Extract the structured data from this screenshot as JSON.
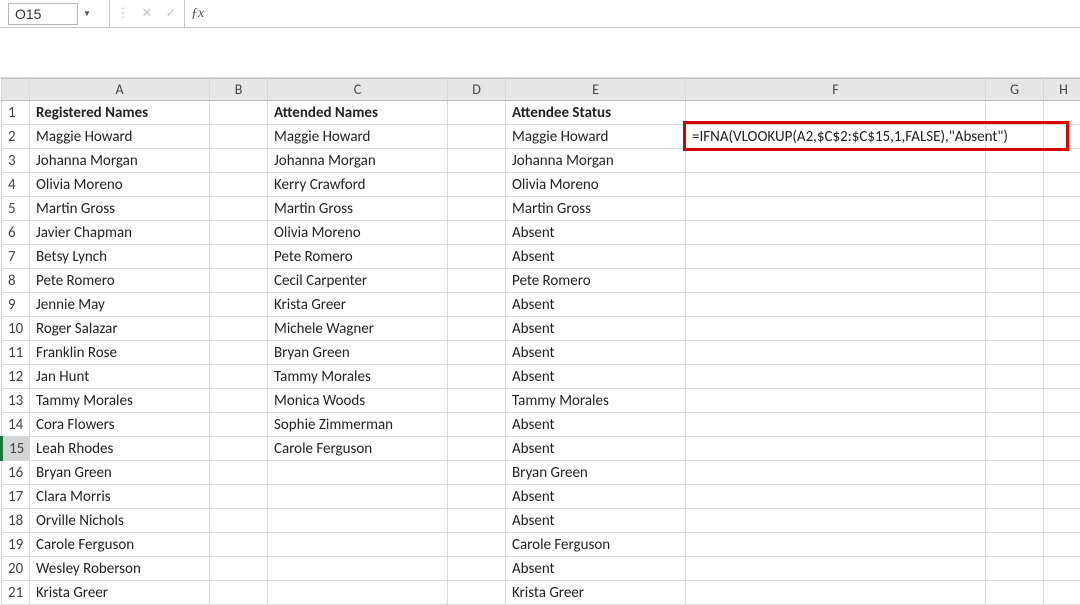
{
  "namebox": {
    "value": "O15"
  },
  "columns": [
    "A",
    "B",
    "C",
    "D",
    "E",
    "F",
    "G",
    "H"
  ],
  "activeRowHeader": 15,
  "headers": {
    "A": "Registered Names",
    "C": "Attended Names",
    "E": "Attendee Status"
  },
  "formulaDisplay": "=IFNA(VLOOKUP(A2,$C$2:$C$15,1,FALSE),\"Absent\")",
  "rows": [
    {
      "n": 2,
      "A": "Maggie Howard",
      "C": "Maggie Howard",
      "E": "Maggie Howard"
    },
    {
      "n": 3,
      "A": "Johanna Morgan",
      "C": "Johanna Morgan",
      "E": "Johanna Morgan"
    },
    {
      "n": 4,
      "A": "Olivia Moreno",
      "C": "Kerry Crawford",
      "E": "Olivia Moreno"
    },
    {
      "n": 5,
      "A": "Martin Gross",
      "C": "Martin Gross",
      "E": "Martin Gross"
    },
    {
      "n": 6,
      "A": "Javier Chapman",
      "C": "Olivia Moreno",
      "E": "Absent"
    },
    {
      "n": 7,
      "A": "Betsy Lynch",
      "C": "Pete Romero",
      "E": "Absent"
    },
    {
      "n": 8,
      "A": "Pete Romero",
      "C": "Cecil Carpenter",
      "E": "Pete Romero"
    },
    {
      "n": 9,
      "A": "Jennie May",
      "C": "Krista Greer",
      "E": "Absent"
    },
    {
      "n": 10,
      "A": "Roger Salazar",
      "C": "Michele Wagner",
      "E": "Absent"
    },
    {
      "n": 11,
      "A": "Franklin Rose",
      "C": "Bryan Green",
      "E": "Absent"
    },
    {
      "n": 12,
      "A": "Jan Hunt",
      "C": "Tammy Morales",
      "E": "Absent"
    },
    {
      "n": 13,
      "A": "Tammy Morales",
      "C": "Monica Woods",
      "E": "Tammy Morales"
    },
    {
      "n": 14,
      "A": "Cora Flowers",
      "C": "Sophie Zimmerman",
      "E": "Absent"
    },
    {
      "n": 15,
      "A": "Leah Rhodes",
      "C": "Carole Ferguson",
      "E": "Absent"
    },
    {
      "n": 16,
      "A": "Bryan Green",
      "C": "",
      "E": "Bryan Green"
    },
    {
      "n": 17,
      "A": "Clara Morris",
      "C": "",
      "E": "Absent"
    },
    {
      "n": 18,
      "A": "Orville Nichols",
      "C": "",
      "E": "Absent"
    },
    {
      "n": 19,
      "A": "Carole Ferguson",
      "C": "",
      "E": "Carole Ferguson"
    },
    {
      "n": 20,
      "A": "Wesley Roberson",
      "C": "",
      "E": "Absent"
    },
    {
      "n": 21,
      "A": "Krista Greer",
      "C": "",
      "E": "Krista Greer"
    }
  ],
  "chart_data": {
    "type": "table",
    "title": "Attendance lookup example",
    "columns": [
      "Registered Names",
      "Attended Names",
      "Attendee Status"
    ],
    "rows": [
      [
        "Maggie Howard",
        "Maggie Howard",
        "Maggie Howard"
      ],
      [
        "Johanna Morgan",
        "Johanna Morgan",
        "Johanna Morgan"
      ],
      [
        "Olivia Moreno",
        "Kerry Crawford",
        "Olivia Moreno"
      ],
      [
        "Martin Gross",
        "Martin Gross",
        "Martin Gross"
      ],
      [
        "Javier Chapman",
        "Olivia Moreno",
        "Absent"
      ],
      [
        "Betsy Lynch",
        "Pete Romero",
        "Absent"
      ],
      [
        "Pete Romero",
        "Cecil Carpenter",
        "Pete Romero"
      ],
      [
        "Jennie May",
        "Krista Greer",
        "Absent"
      ],
      [
        "Roger Salazar",
        "Michele Wagner",
        "Absent"
      ],
      [
        "Franklin Rose",
        "Bryan Green",
        "Absent"
      ],
      [
        "Jan Hunt",
        "Tammy Morales",
        "Absent"
      ],
      [
        "Tammy Morales",
        "Monica Woods",
        "Tammy Morales"
      ],
      [
        "Cora Flowers",
        "Sophie Zimmerman",
        "Absent"
      ],
      [
        "Leah Rhodes",
        "Carole Ferguson",
        "Absent"
      ],
      [
        "Bryan Green",
        "",
        "Bryan Green"
      ],
      [
        "Clara Morris",
        "",
        "Absent"
      ],
      [
        "Orville Nichols",
        "",
        "Absent"
      ],
      [
        "Carole Ferguson",
        "",
        "Carole Ferguson"
      ],
      [
        "Wesley Roberson",
        "",
        "Absent"
      ],
      [
        "Krista Greer",
        "",
        "Krista Greer"
      ]
    ],
    "formula_in_F2": "=IFNA(VLOOKUP(A2,$C$2:$C$15,1,FALSE),\"Absent\")"
  }
}
